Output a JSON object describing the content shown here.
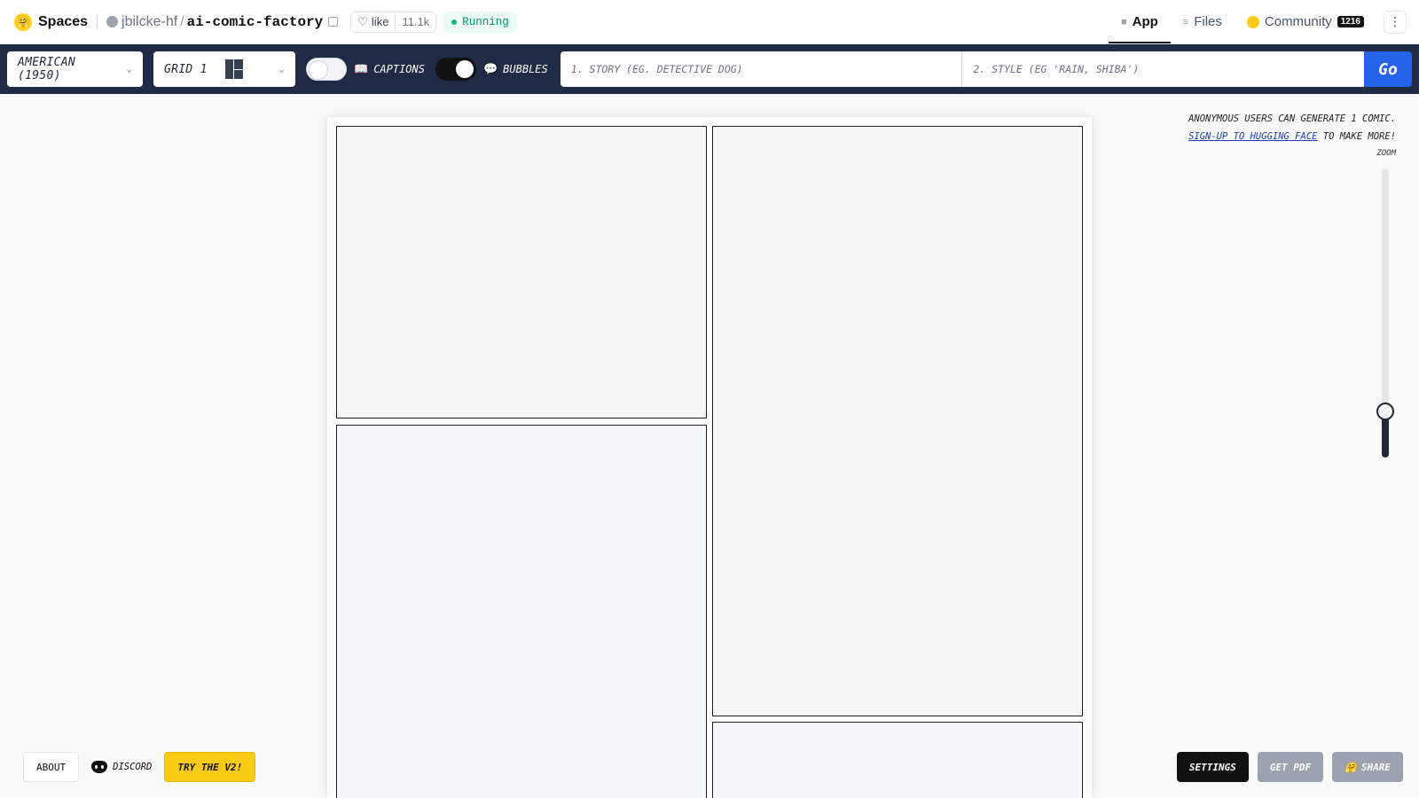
{
  "hf": {
    "spaces": "Spaces",
    "owner": "jbilcke-hf",
    "slash": "/",
    "repo": "ai-comic-factory",
    "like_label": "like",
    "like_count": "11.1k",
    "status": "Running",
    "tabs": [
      {
        "label": "App"
      },
      {
        "label": "Files"
      },
      {
        "label": "Community",
        "badge": "1216"
      }
    ],
    "more": "⋮"
  },
  "toolbar": {
    "style_value": "American (1950)",
    "grid_value": "Grid 1",
    "captions_label": "Captions",
    "captions_on": false,
    "bubbles_label": "Bubbles",
    "bubbles_on": true,
    "story_placeholder": "1. Story (eg. detective dog)",
    "style_placeholder": "2. Style (eg 'rain, shiba')",
    "go_label": "Go"
  },
  "notice": {
    "line1": "Anonymous users can generate 1 comic.",
    "link": "Sign-up to Hugging Face",
    "line2_rest": " to make more!"
  },
  "zoom": {
    "label": "Zoom",
    "level": 0.16
  },
  "bottom_left": {
    "about": "About",
    "discord": "Discord",
    "try_v2": "Try the V2!"
  },
  "bottom_right": {
    "settings": "Settings",
    "get_pdf": "Get PDF",
    "share": "Share"
  },
  "icons": {
    "logo": "hugging-face-icon",
    "copy": "copy-icon",
    "heart": "heart-icon",
    "captions": "book-icon",
    "bubbles": "speech-bubble-icon",
    "discord": "discord-icon",
    "share": "hugging-face-icon"
  },
  "colors": {
    "toolbar_bg": "#1f2a44",
    "go_blue": "#2563eb",
    "v2_yellow": "#facc15",
    "running_green": "#059669"
  }
}
